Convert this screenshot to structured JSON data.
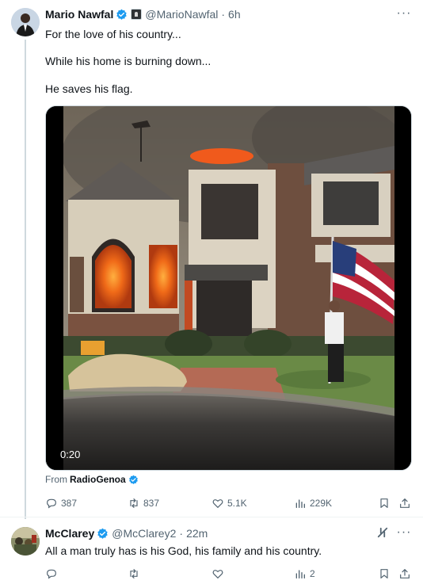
{
  "posts": [
    {
      "author": "Mario Nawfal",
      "handle": "@MarioNawfal",
      "separator": "·",
      "time": "6h",
      "more": "···",
      "lines": [
        "For the love of his country...",
        "While his home is burning down...",
        "He saves his flag."
      ],
      "media": {
        "duration": "0:20"
      },
      "from_label": "From",
      "from_source": "RadioGenoa",
      "stats": {
        "replies": "387",
        "reposts": "837",
        "likes": "5.1K",
        "views": "229K"
      }
    },
    {
      "author": "McClarey",
      "handle": "@McClarey2",
      "separator": "·",
      "time": "22m",
      "more": "···",
      "lines": [
        "All a man truly has is his God, his family and his country."
      ],
      "stats": {
        "replies": "",
        "reposts": "",
        "likes": "",
        "views": "2"
      }
    }
  ],
  "colors": {
    "verified": "#1d9bf0",
    "secondary_text": "#536471",
    "primary_text": "#0f1419",
    "divider": "#eff3f4"
  },
  "icons": [
    "verified-badge-icon",
    "affiliate-badge-icon",
    "more-icon",
    "grok-icon",
    "reply-icon",
    "repost-icon",
    "like-icon",
    "views-icon",
    "bookmark-icon",
    "share-icon"
  ]
}
